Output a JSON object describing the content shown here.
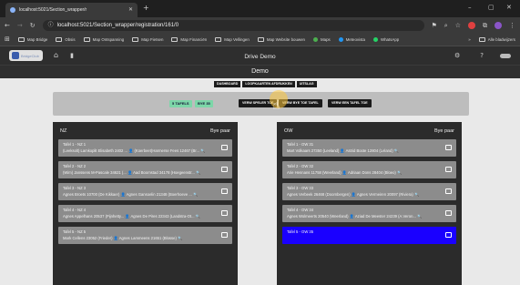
{
  "browser": {
    "tab_title": "localhost:5021/Section_wrapper/r",
    "url": "localhost:5021/Section_wrapper/registration/161/0",
    "bookmarks": [
      "Map Bridge",
      "Obsis",
      "Map Ontspanning",
      "Map Fietsen",
      "Map Financiën",
      "Map Vellingen",
      "Map Website bouwen",
      "Maps",
      "Meteovista",
      "WhatsApp"
    ],
    "bookmarks_overflow": "»",
    "all_bookmarks": "Alle bladwijzers"
  },
  "navbar": {
    "logo_text": "BridgeClub",
    "title": "Drive Demo"
  },
  "main": {
    "demo_label": "Demo",
    "top_nav": [
      "DASHBOARD",
      "LOOPKAARTEN AFDRUKKEN",
      "UITSLAG"
    ],
    "tags": [
      "5 TAFELS",
      "BYE 35"
    ],
    "actions": [
      "VERW SPELER TOE",
      "VERW BYE TOE TAFEL",
      "VERW EEN TAFEL TOE"
    ],
    "nz": {
      "title": "NZ",
      "col_bye": "Bye paar",
      "rows": [
        {
          "l1": "Tafel 1 - NZ 1",
          "l2": "(Leeksolt) Lamkoplit Elisabeth 2402 ... 👤 (Koerbeet)Harmerse Fees 12467 (Br... 🔍"
        },
        {
          "l1": "Tafel 2 - NZ 2",
          "l2": "(Wim) Janssens M-Pascale 34621 (... 👤 Aad Boomstad 34178 (Hoegeenstr... 🔍"
        },
        {
          "l1": "Tafel 3 - NZ 3",
          "l2": "Agnes Broets 10700 (De Kikkaer) 👤 Agnes Gansoelin 21348 (Boerhoeve ... 🔍"
        },
        {
          "l1": "Tafel 4 - NZ 4",
          "l2": "Agnes Appelhans 20537 (Pijnhetty... 👤 Agnes De Pires 22343 (Landstra-Ot... 🔍"
        },
        {
          "l1": "Tafel 5 - NZ 5",
          "l2": "Mark Cellens 23052 (Frieder) 👤 Agnes Lammeens 21651 (Blosse) 🔍"
        }
      ]
    },
    "ow": {
      "title": "OW",
      "col_bye": "Bye paar",
      "rows": [
        {
          "l1": "Tafel 1 - OW 31",
          "l2": "Mart Volkaars 27350 (Leeland) 👤 Astrid Boote 12804 (Leland) 🔍"
        },
        {
          "l1": "Tafel 2 - OW 32",
          "l2": "Arie Hennans 11758 (Weerland) 👤 Adriaan Dons 28404 (Bloeo) 🔍"
        },
        {
          "l1": "Tafel 3 - OW 33",
          "l2": "Agnes Verbeek 26468 (Doornbergen) 👤 Agnes Vermeiren 20097 (Riviera) 🔍"
        },
        {
          "l1": "Tafel 4 - OW 34",
          "l2": "Agnes Wolmeerts 20540 (Weerland) 👤 Aziad De Meester 24239 (A.Veron... 🔍"
        },
        {
          "l1": "Tafel 5 - OW 35",
          "l2": ""
        }
      ]
    }
  },
  "colors": {
    "selected_row": "#1a00ff",
    "tag_green": "#7dd6a8",
    "panel_dark": "#2b2b2b"
  }
}
